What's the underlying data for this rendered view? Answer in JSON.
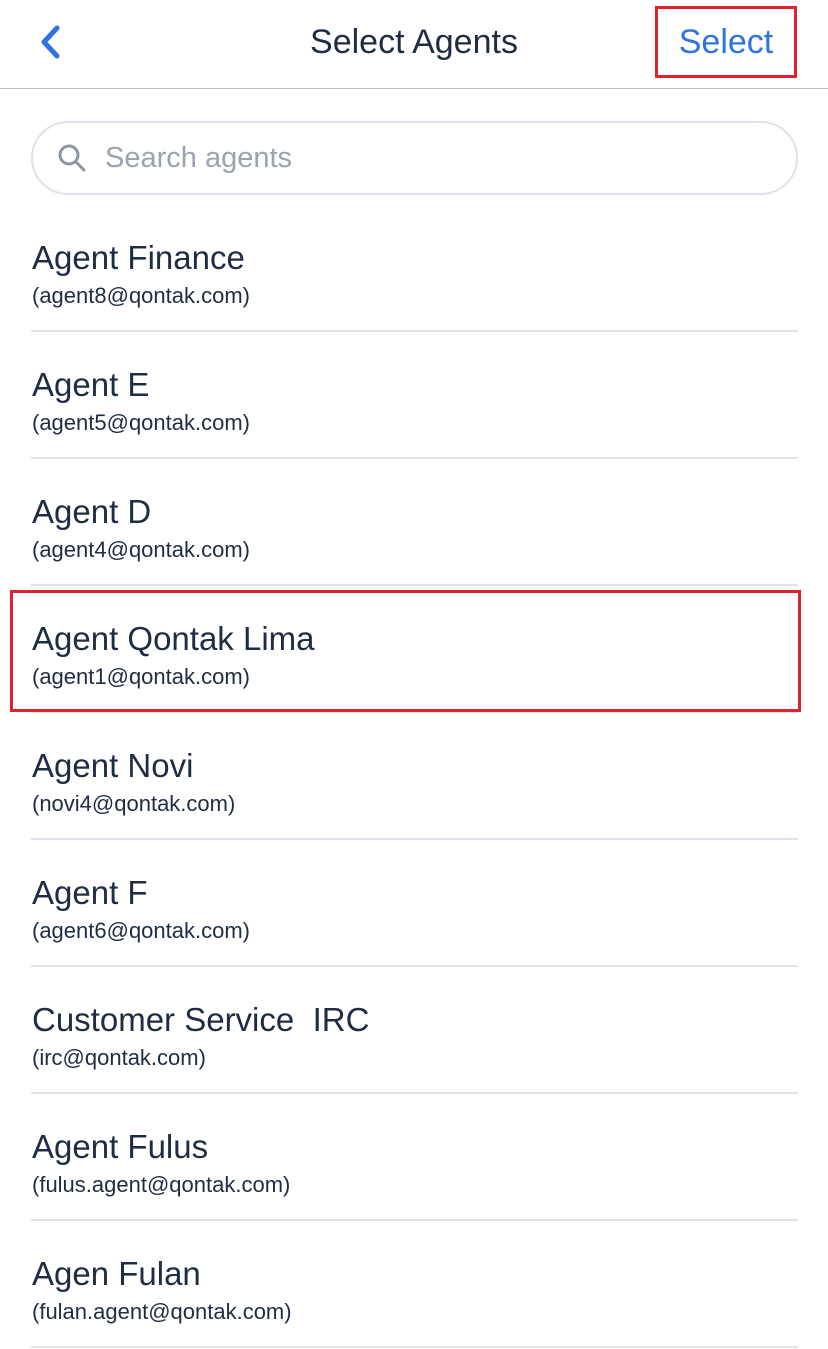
{
  "header": {
    "title": "Select Agents",
    "select_label": "Select",
    "back_icon": "chevron-left-icon"
  },
  "search": {
    "placeholder": "Search agents",
    "value": "",
    "icon": "search-icon"
  },
  "agents": [
    {
      "name": "Agent Finance",
      "email": "(agent8@qontak.com)"
    },
    {
      "name": "Agent E",
      "email": "(agent5@qontak.com)"
    },
    {
      "name": "Agent D",
      "email": "(agent4@qontak.com)"
    },
    {
      "name": "Agent Qontak Lima",
      "email": "(agent1@qontak.com)"
    },
    {
      "name": "Agent Novi",
      "email": "(novi4@qontak.com)"
    },
    {
      "name": "Agent F",
      "email": "(agent6@qontak.com)"
    },
    {
      "name": "Customer Service  IRC",
      "email": "(irc@qontak.com)"
    },
    {
      "name": "Agent Fulus",
      "email": "(fulus.agent@qontak.com)"
    },
    {
      "name": "Agen Fulan",
      "email": "(fulan.agent@qontak.com)"
    }
  ],
  "colors": {
    "accent": "#2f73e0",
    "text": "#1f2d44",
    "highlight": "#e0222e",
    "divider": "#dfe4ea"
  }
}
